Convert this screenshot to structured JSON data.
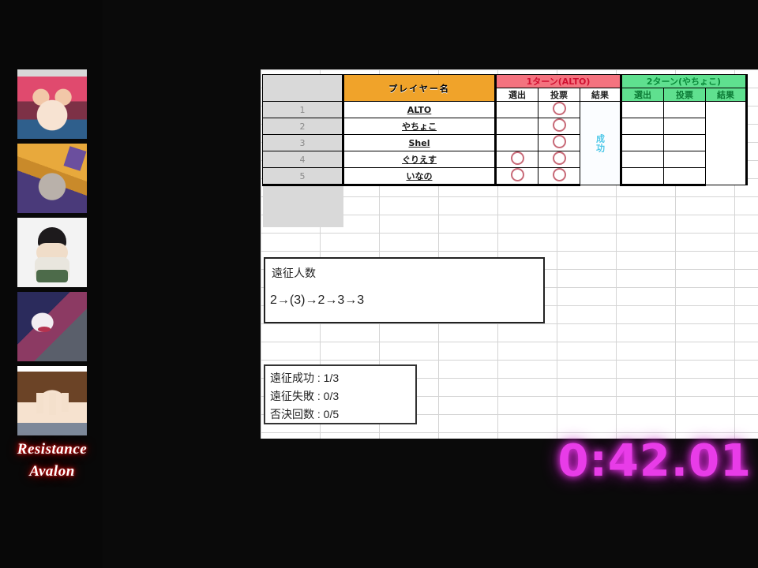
{
  "stream": {
    "game_title_line1": "Resistance",
    "game_title_line2": "Avalon",
    "timer": "0:42.01",
    "avatars": [
      {
        "name": "avatar-1"
      },
      {
        "name": "avatar-2"
      },
      {
        "name": "avatar-3"
      },
      {
        "name": "avatar-4"
      },
      {
        "name": "avatar-5"
      }
    ]
  },
  "sheet": {
    "headers": {
      "index_col": "",
      "player_name": "プレイヤー名",
      "turn1": "1ターン(ALTO)",
      "turn2": "2ターン(やちょこ)",
      "sub": [
        "選出",
        "投票",
        "結果"
      ]
    },
    "rows": [
      {
        "idx": "1",
        "name": "ALTO",
        "t1_select": "",
        "t1_vote": "○",
        "t2_select": "",
        "t2_vote": "",
        "t2_result": ""
      },
      {
        "idx": "2",
        "name": "やちょこ",
        "t1_select": "",
        "t1_vote": "○",
        "t2_select": "",
        "t2_vote": "",
        "t2_result": ""
      },
      {
        "idx": "3",
        "name": "Shel",
        "t1_select": "",
        "t1_vote": "○",
        "t2_select": "",
        "t2_vote": "",
        "t2_result": ""
      },
      {
        "idx": "4",
        "name": "ぐりえす",
        "t1_select": "○",
        "t1_vote": "○",
        "t2_select": "",
        "t2_vote": "",
        "t2_result": ""
      },
      {
        "idx": "5",
        "name": "いなの",
        "t1_select": "○",
        "t1_vote": "○",
        "t2_select": "",
        "t2_vote": "",
        "t2_result": ""
      }
    ],
    "turn1_result": "成功",
    "expedition": {
      "label": "遠征人数",
      "sequence": "2→(3)→2→3→3"
    },
    "stats": {
      "success": "遠征成功 : 1/3",
      "failure": "遠征失敗 : 0/3",
      "rejected": "否決回数 : 0/5"
    }
  },
  "colors": {
    "name_header": "#f0a32a",
    "turn1_header": "#f4737f",
    "turn2_header": "#5fe08f",
    "result_text": "#4ec8e8",
    "timer": "#e83ce8",
    "mark": "#c86a78"
  }
}
